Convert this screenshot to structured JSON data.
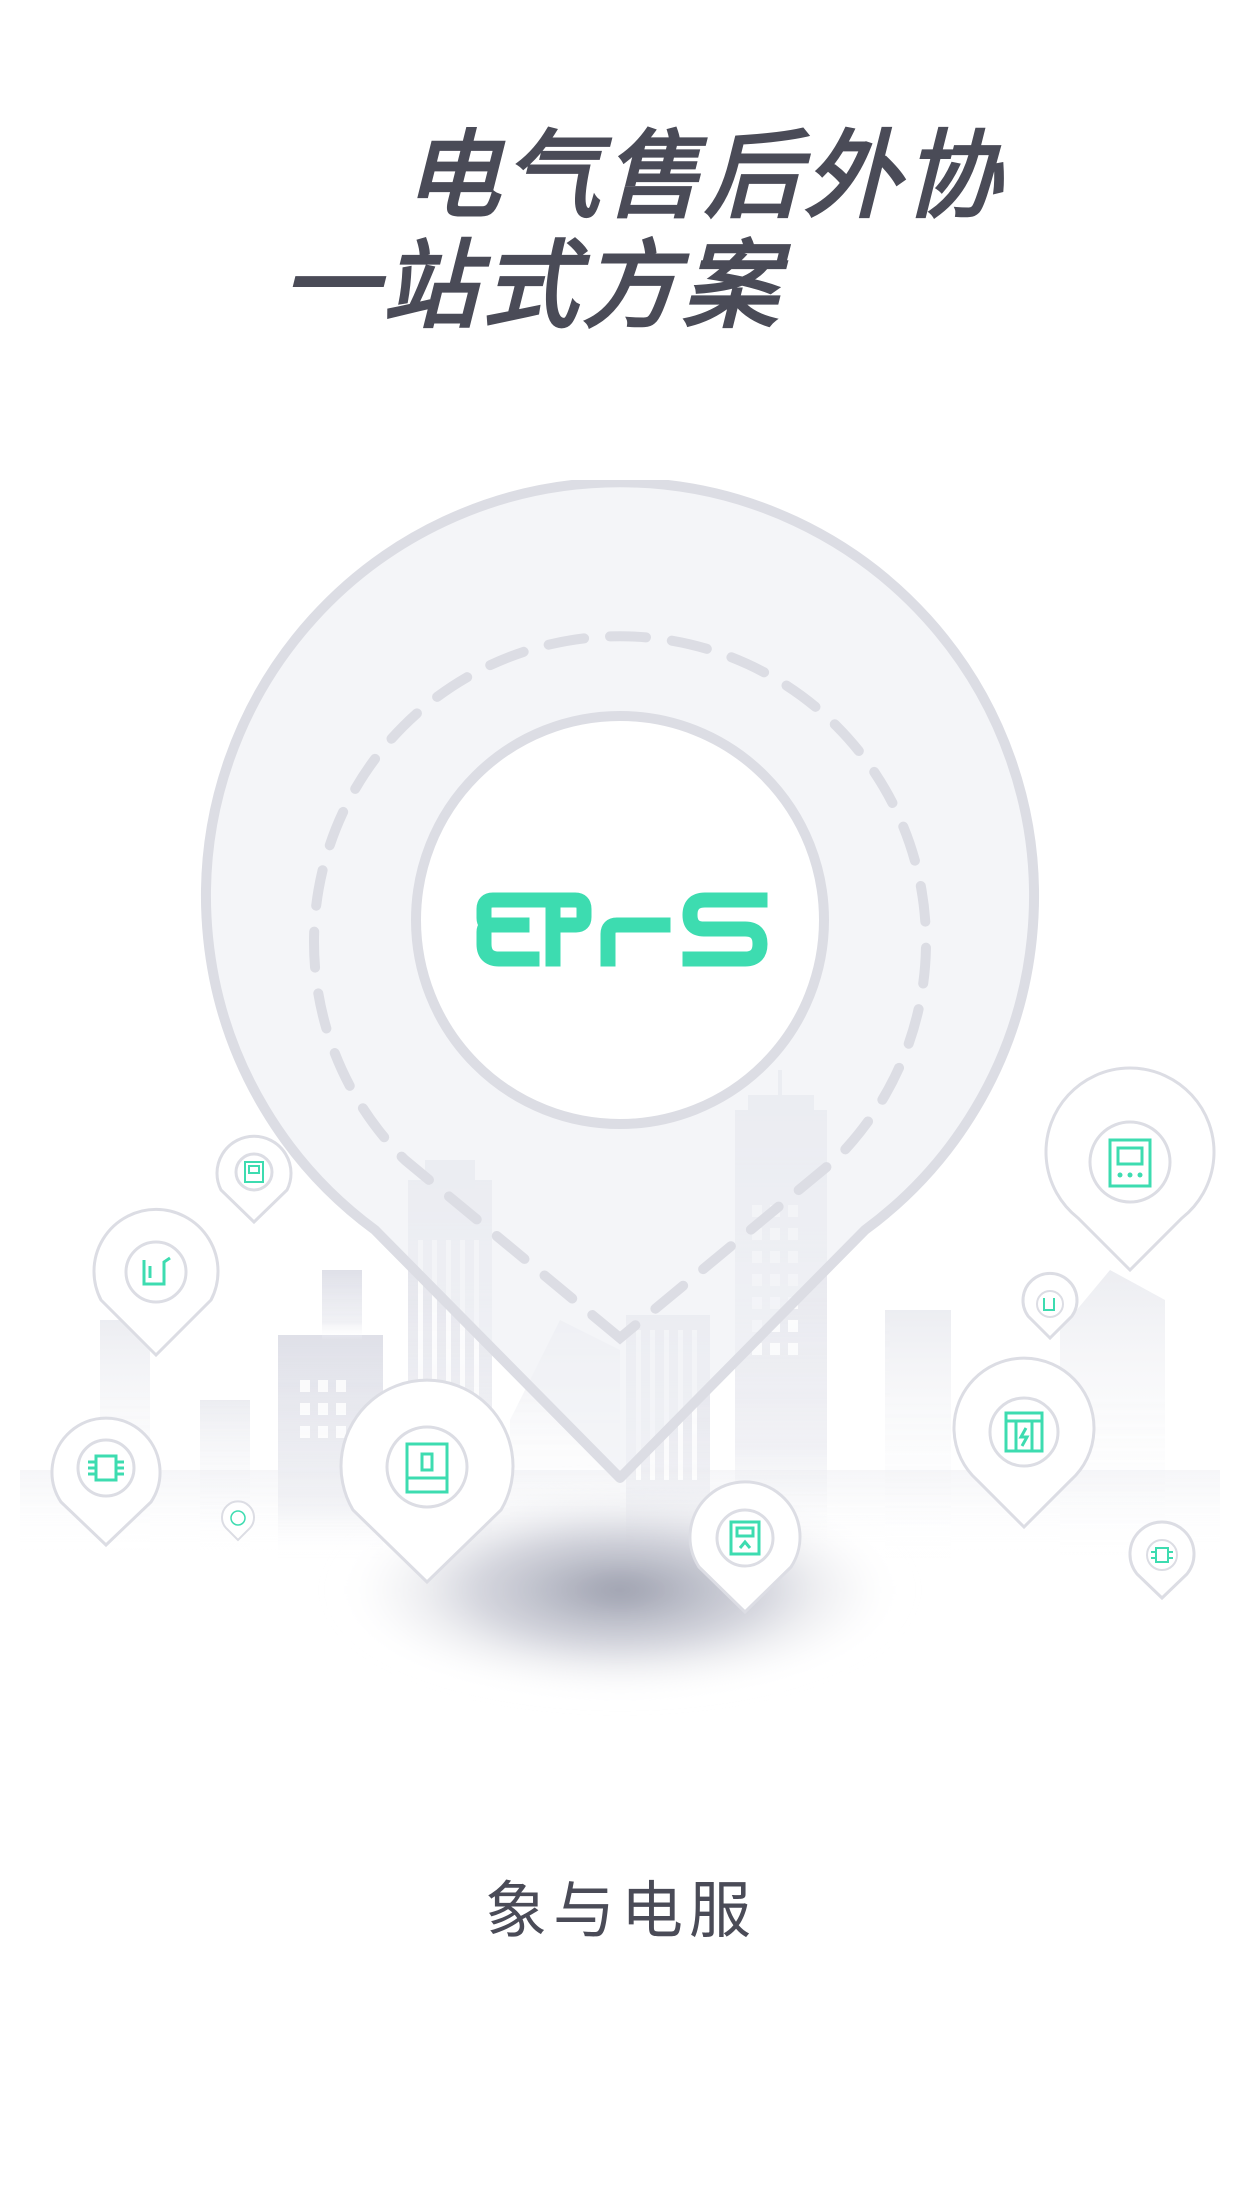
{
  "headline": {
    "line1": "电气售后外协",
    "line2": "一站式方案"
  },
  "logo": {
    "text": "EPS",
    "color": "#3ddcb0"
  },
  "app_name": "象与电服",
  "colors": {
    "text": "#4a4b57",
    "accent": "#3ddcb0",
    "pin_fill": "#f0f1f5",
    "pin_stroke": "#dcdde4"
  },
  "icons": [
    "lightning-cabinet-icon",
    "control-panel-icon",
    "circuit-chip-icon",
    "cable-icon",
    "inverter-icon",
    "meter-icon"
  ]
}
